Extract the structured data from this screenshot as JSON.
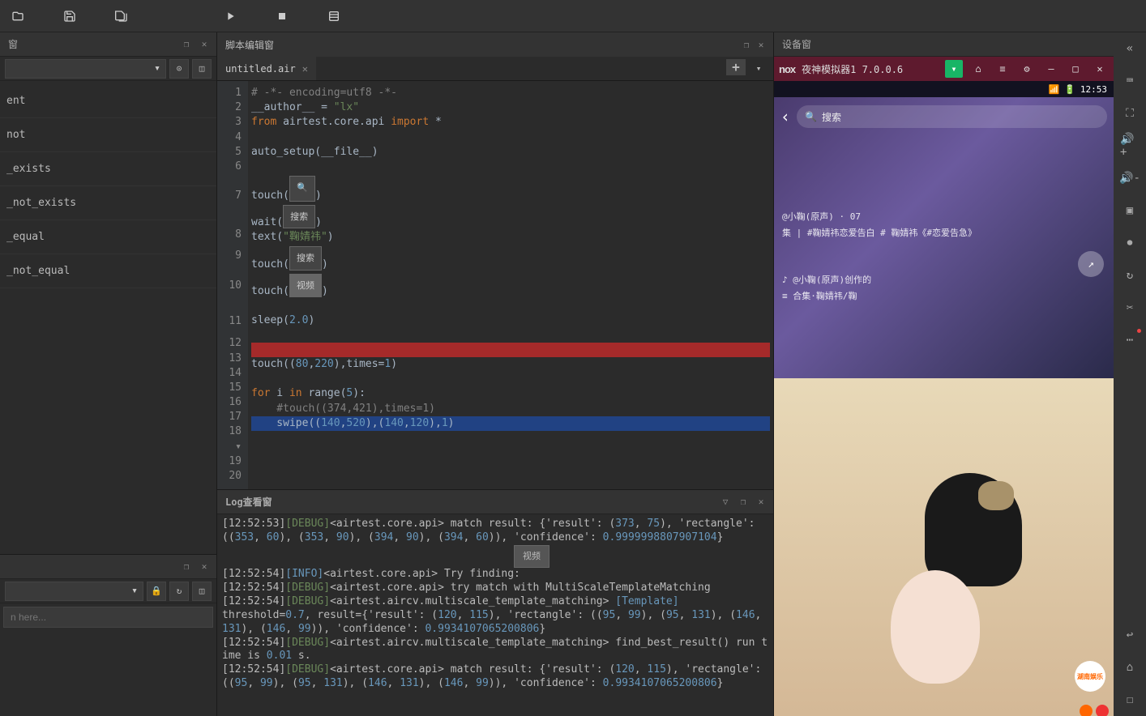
{
  "toolbar": {},
  "left_panel": {
    "header_title": "窗",
    "tree_items": [
      "ent",
      "not",
      "_exists",
      "_not_exists",
      "_equal",
      "_not_equal"
    ],
    "helper_placeholder": "n here..."
  },
  "script_panel": {
    "title": "脚本编辑窗",
    "tab_name": "untitled.air"
  },
  "code": {
    "line1": "# -*- encoding=utf8 -*-",
    "line2_a": "__author__ = ",
    "line2_b": "\"lx\"",
    "line3_a": "from",
    "line3_b": " airtest.core.api ",
    "line3_c": "import",
    "line3_d": " *",
    "line5": "auto_setup(__file__)",
    "line7a": "touch(",
    "search_label": "搜索",
    "line8a": "wait(",
    "line9a": "text(",
    "line9b": "\"鞠婧祎\"",
    "line10a": "touch(",
    "video_label": "视频",
    "line11a": "touch(",
    "line13": "sleep(",
    "line13b": "2.0",
    "line16_a": "touch((",
    "line16_b": "80",
    "line16_c": ",",
    "line16_d": "220",
    "line16_e": "),times=",
    "line16_f": "1",
    "line16_g": ")",
    "line18_a": "for",
    "line18_b": " i ",
    "line18_c": "in",
    "line18_d": " range(",
    "line18_e": "5",
    "line18_f": "):",
    "line19": "    #touch((374,421),times=1)",
    "line20_a": "    swipe((",
    "line20_b": "140",
    "line20_c": ",",
    "line20_d": "520",
    "line20_e": "),(",
    "line20_f": "140",
    "line20_g": ",",
    "line20_h": "120",
    "line20_i": "),",
    "line20_j": "1",
    "line20_k": ")"
  },
  "gutter": [
    "1",
    "2",
    "3",
    "4",
    "5",
    "6",
    "",
    "7",
    "",
    "8",
    "9",
    "",
    "10",
    "",
    "11",
    "12",
    "13",
    "14",
    "15",
    "16",
    "17",
    "18",
    "19",
    "20"
  ],
  "log_panel": {
    "title": "Log查看窗",
    "thumb_label": "视频",
    "lines": {
      "l1_ts": "[12:52:53]",
      "l1_lvl": "[DEBUG]",
      "l1_txt": "<airtest.core.api> match result: {'result': (",
      "l1_n1": "373",
      "l1_n2": "75",
      "l1_txt2": "), 'rectangle': ((",
      "l2_n1": "353",
      "l2_n2": "60",
      "l2_n3": "353",
      "l2_n4": "90",
      "l2_n5": "394",
      "l2_n6": "90",
      "l2_n7": "394",
      "l2_n8": "60",
      "l2_txt": ")), 'confidence': ",
      "l2_conf": "0.9999998807907104",
      "l3_ts": "[12:52:54]",
      "l3_lvl": "[INFO]",
      "l3_txt": "<airtest.core.api> Try finding:",
      "l4_ts": "[12:52:54]",
      "l4_lvl": "[DEBUG]",
      "l4_txt": "<airtest.core.api> try match with MultiScaleTemplateMatching",
      "l5_ts": "[12:52:54]",
      "l5_lvl": "[DEBUG]",
      "l5_txt": "<airtest.aircv.multiscale_template_matching> ",
      "l5_tmpl": "[Template]",
      "l6_a": "threshold=",
      "l6_n1": "0.7",
      "l6_b": ", result={'result': (",
      "l6_n2": "120",
      "l6_n3": "115",
      "l6_c": "), 'rectangle': ((",
      "l6_n4": "95",
      "l6_n5": "99",
      "l6_n6": "95",
      "l6_n7": "131",
      "l6_n8": "146",
      "l7_n1": "131",
      "l7_n2": "146",
      "l7_n3": "99",
      "l7_a": ")), 'confidence': ",
      "l7_conf": "0.9934107065200806",
      "l8_ts": "[12:52:54]",
      "l8_lvl": "[DEBUG]",
      "l8_txt": "<airtest.aircv.multiscale_template_matching> find_best_result() run time is ",
      "l8_n1": "0.01",
      "l8_b": " s.",
      "l9_ts": "[12:52:54]",
      "l9_lvl": "[DEBUG]",
      "l9_txt": "<airtest.core.api> match result: {'result': (",
      "l9_n1": "120",
      "l9_n2": "115",
      "l9_b": "), 'rectangle': ((",
      "l10_n1": "95",
      "l10_n2": "99",
      "l10_n3": "95",
      "l10_n4": "131",
      "l10_n5": "146",
      "l10_n6": "131",
      "l10_n7": "146",
      "l10_n8": "99",
      "l10_a": ")), 'confidence': ",
      "l10_conf": "0.9934107065200806"
    }
  },
  "device_panel": {
    "title": "设备窗",
    "emulator_name": "夜神模拟器1 7.0.0.6",
    "nox": "nox",
    "status_time": "12:53",
    "search_placeholder": "搜索",
    "overlay_author": "@小鞠(原声) · 07",
    "overlay_desc": "集 | #鞠婧祎恋爱告白 # 鞠婧祎《#恋爱告急》",
    "overlay_music": "@小鞠(原声)创作的",
    "overlay_collection": "合集·鞠婧祎/鞠",
    "watermark": "湖南娱乐"
  }
}
